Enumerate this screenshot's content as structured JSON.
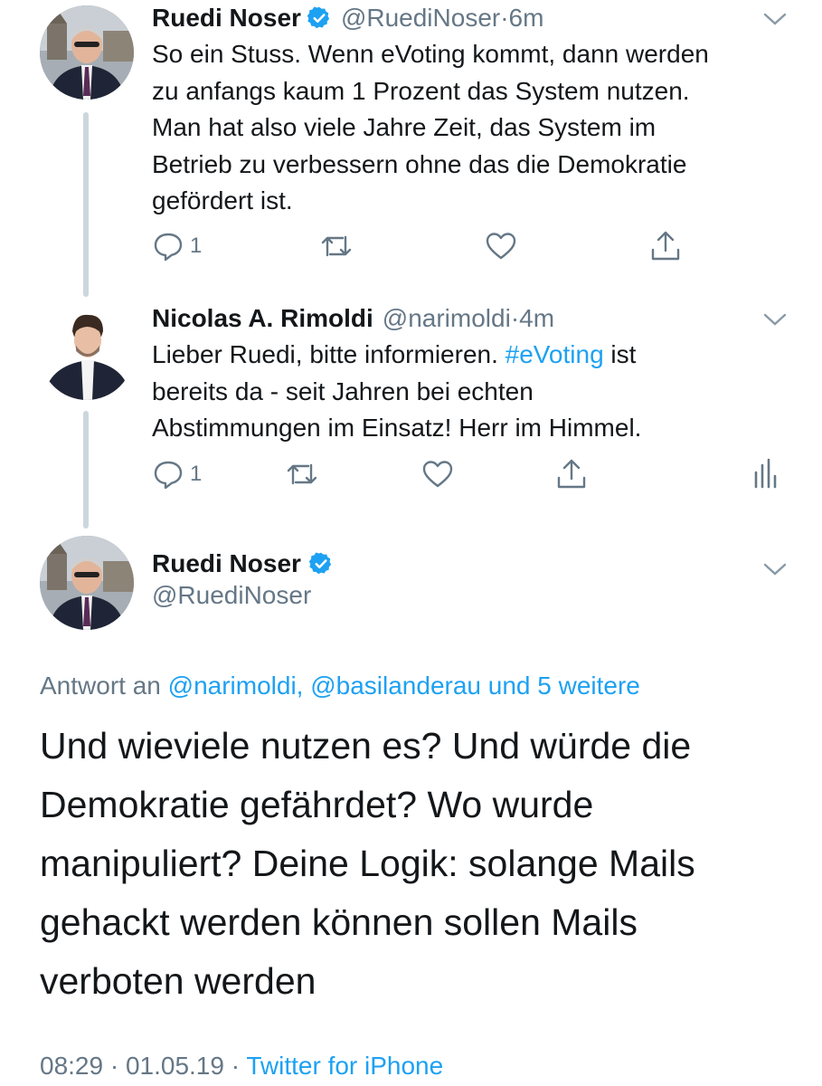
{
  "tweets": [
    {
      "name": "Ruedi Noser",
      "handle": "@RuediNoser",
      "time": "6m",
      "text": [
        "So ein Stuss. Wenn eVoting kommt, dann werden",
        "zu anfangs kaum 1 Prozent das System nutzen.",
        "Man hat also viele Jahre Zeit, das System im",
        "Betrieb zu verbessern ohne das die Demokratie",
        "gefördert ist."
      ],
      "reply_count": "1"
    },
    {
      "name": "Nicolas A. Rimoldi",
      "handle": "@narimoldi",
      "time": "4m",
      "text_before_tag": "Lieber Ruedi, bitte informieren. ",
      "hashtag": "#eVoting",
      "text_after_tag": " ist",
      "text_rest": [
        "bereits da - seit Jahren bei echten",
        "Abstimmungen im Einsatz! Herr im Himmel."
      ],
      "reply_count": "1"
    }
  ],
  "main_tweet": {
    "name": "Ruedi Noser",
    "handle": "@RuediNoser",
    "reply_prefix": "Antwort an ",
    "reply_to": "@narimoldi, @basilanderau und 5 weitere",
    "text": [
      "Und wieviele nutzen es? Und würde die",
      "Demokratie gefährdet? Wo wurde",
      "manipuliert? Deine Logik: solange Mails",
      "gehackt werden können sollen Mails",
      "verboten werden"
    ],
    "timestamp": "08:29 · 01.05.19 · ",
    "source": "Twitter for iPhone"
  },
  "separator": " · ",
  "icons": {
    "verified": "verified-badge-icon",
    "chevron": "chevron-down-icon",
    "reply": "reply-icon",
    "retweet": "retweet-icon",
    "like": "like-icon",
    "share": "share-icon",
    "analytics": "analytics-icon"
  },
  "colors": {
    "accent": "#1da1f2",
    "secondary_text": "#657786",
    "thread_line": "#ccd6dd"
  }
}
